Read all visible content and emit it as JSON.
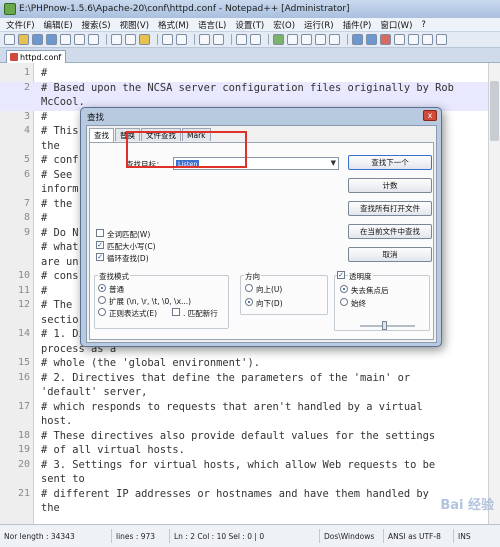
{
  "window": {
    "title": "E:\\PHPnow-1.5.6\\Apache-20\\conf\\httpd.conf - Notepad++ [Administrator]"
  },
  "menu": [
    "文件(F)",
    "编辑(E)",
    "搜索(S)",
    "视图(V)",
    "格式(M)",
    "语言(L)",
    "设置(T)",
    "宏(O)",
    "运行(R)",
    "插件(P)",
    "窗口(W)",
    "?"
  ],
  "tab": {
    "label": "httpd.conf"
  },
  "editor": {
    "lines": [
      {
        "n": "1",
        "text": "#"
      },
      {
        "n": "2",
        "text": "# Based upon the NCSA server configuration files originally by Rob"
      },
      {
        "n": "",
        "text": "McCool."
      },
      {
        "n": "3",
        "text": "#"
      },
      {
        "n": "4",
        "text": "# This                                                        ns"
      },
      {
        "n": "",
        "text": "the"
      },
      {
        "n": "5",
        "text": "# conf                                                        s."
      },
      {
        "n": "6",
        "text": "# See"
      },
      {
        "n": "",
        "text": "inform"
      },
      {
        "n": "7",
        "text": "# the"
      },
      {
        "n": "8",
        "text": "#"
      },
      {
        "n": "9",
        "text": "# Do N                                                        ding"
      },
      {
        "n": "",
        "text": "# what                                                         ou"
      },
      {
        "n": "",
        "text": "are un"
      },
      {
        "n": "10",
        "text": "# cons"
      },
      {
        "n": "11",
        "text": "#"
      },
      {
        "n": "12",
        "text": "# The"
      },
      {
        "n": "",
        "text": "sectio"
      },
      {
        "n": "14",
        "text": "#  1. Directives that control the operation of the Apache server"
      },
      {
        "n": "",
        "text": "process as a"
      },
      {
        "n": "15",
        "text": "#     whole (the 'global environment')."
      },
      {
        "n": "16",
        "text": "#  2. Directives that define the parameters of the 'main' or"
      },
      {
        "n": "",
        "text": "'default' server,"
      },
      {
        "n": "17",
        "text": "#     which responds to requests that aren't handled by a virtual"
      },
      {
        "n": "",
        "text": "host."
      },
      {
        "n": "18",
        "text": "#     These directives also provide default values for the settings"
      },
      {
        "n": "19",
        "text": "#     of all virtual hosts."
      },
      {
        "n": "20",
        "text": "#  3. Settings for virtual hosts, which allow Web requests to be"
      },
      {
        "n": "",
        "text": "sent to"
      },
      {
        "n": "21",
        "text": "#     different IP addresses or hostnames and have them handled by"
      },
      {
        "n": "",
        "text": "the"
      }
    ]
  },
  "status": [
    "Nor length : 34343",
    "lines : 973",
    "Ln : 2   Col : 10   Sel : 0 | 0",
    "Dos\\Windows",
    "ANSI as UTF-8",
    "INS"
  ],
  "dialog": {
    "title": "查找",
    "close": "x",
    "tabs": [
      "查找",
      "替换",
      "文件查找",
      "Mark"
    ],
    "target_label": "查找目标：",
    "target_value": "Listen",
    "buttons": [
      "查找下一个",
      "计数",
      "查找所有打开文件",
      "在当前文件中查找",
      "取消"
    ],
    "options": {
      "whole_word": "全词匹配(W)",
      "match_case": "匹配大小写(C)",
      "wrap": "循环查找(D)"
    },
    "mode": {
      "title": "查找模式",
      "normal": "普通",
      "extended": "扩展 (\\n, \\r, \\t, \\0, \\x...)",
      "regex": "正则表达式(E)",
      "newline": ". 匹配新行"
    },
    "direction": {
      "title": "方向",
      "up": "向上(U)",
      "down": "向下(D)"
    },
    "transparency": {
      "title": "透明度",
      "on_blur": "失去焦点后",
      "always": "始终"
    }
  },
  "watermark": "Bai 经验"
}
